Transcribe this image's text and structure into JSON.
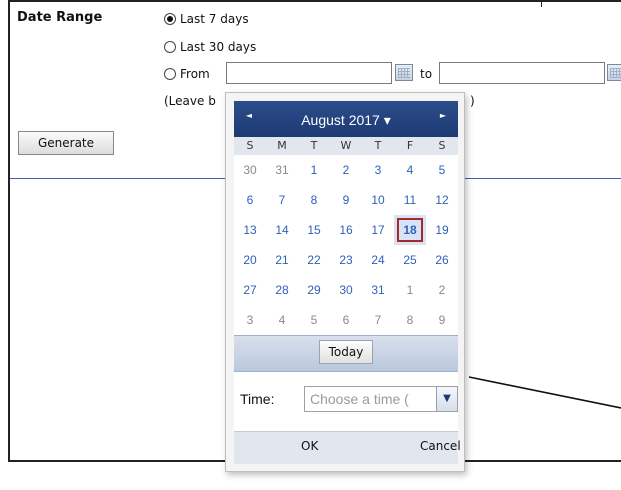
{
  "form": {
    "date_range_label": "Date Range",
    "options": {
      "last7": "Last 7 days",
      "last30": "Last 30 days",
      "from": "From"
    },
    "to_label": "to",
    "leave_blank_text": "(Leave b",
    "leave_blank_tail": ")",
    "generate_label": "Generate"
  },
  "datepicker": {
    "prev_icon": "◄",
    "next_icon": "►",
    "month_title": "August 2017 ▾",
    "weekdays": [
      "S",
      "M",
      "T",
      "W",
      "T",
      "F",
      "S"
    ],
    "days": [
      "30",
      "31",
      "1",
      "2",
      "3",
      "4",
      "5",
      "6",
      "7",
      "8",
      "9",
      "10",
      "11",
      "12",
      "13",
      "14",
      "15",
      "16",
      "17",
      "18",
      "19",
      "20",
      "21",
      "22",
      "23",
      "24",
      "25",
      "26",
      "27",
      "28",
      "29",
      "30",
      "31",
      "1",
      "2",
      "3",
      "4",
      "5",
      "6",
      "7",
      "8",
      "9"
    ],
    "selected_day": "18",
    "today_label": "Today",
    "time_label": "Time:",
    "time_placeholder": "Choose a time (",
    "time_dropdown_icon": "▼",
    "ok_label": "OK",
    "cancel_label": "Cancel"
  },
  "colors": {
    "header_blue": "#1d3a72",
    "day_blue": "#2f62b8",
    "selected_border": "#a32a2a",
    "separator_blue": "#3a63b8"
  }
}
